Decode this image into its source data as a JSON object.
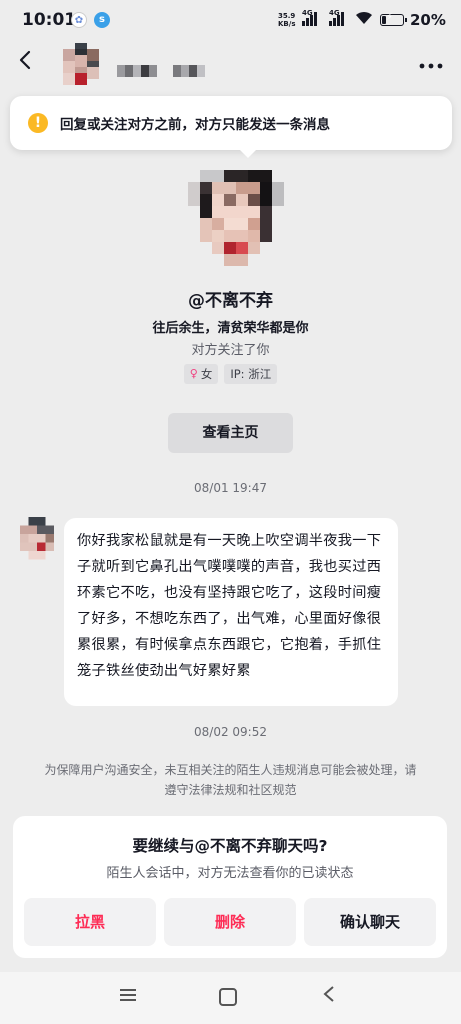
{
  "status_bar": {
    "time": "10:01",
    "net_speed_value": "35.9",
    "net_speed_unit": "KB/s",
    "signal1_label": "4G",
    "signal2_label": "4G",
    "battery_percent": "20%",
    "battery_level": 0.2,
    "icons": [
      "app-notification-icon",
      "app-notification-icon-2",
      "signal-icon",
      "wifi-icon",
      "battery-icon"
    ]
  },
  "header": {
    "back_icon": "chevron-left-icon",
    "more_icon": "more-dots-icon"
  },
  "notice": {
    "icon": "warning-icon",
    "text": "回复或关注对方之前，对方只能发送一条消息"
  },
  "profile": {
    "nickname": "@不离不弃",
    "bio": "往后余生，清贫荣华都是你",
    "follow_note": "对方关注了你",
    "tags": [
      "女",
      "IP: 浙江"
    ],
    "view_home_label": "查看主页"
  },
  "messages": [
    {
      "timestamp": "08/01 19:47",
      "text": "你好我家松鼠就是有一天晚上吹空调半夜我一下子就听到它鼻孔出气噗噗噗的声音，我也买过西环素它不吃，也没有坚持跟它吃了，这段时间瘦了好多，不想吃东西了，出气难，心里面好像很累很累，有时候拿点东西跟它，它抱着，手抓住笼子铁丝使劲出气好累好累"
    }
  ],
  "system": {
    "timestamp": "08/02 09:52",
    "safety_notice": "为保障用户沟通安全，未互相关注的陌生人违规消息可能会被处理，请遵守法律法规和社区规范"
  },
  "continue_card": {
    "title": "要继续与@不离不弃聊天吗?",
    "subtitle": "陌生人会话中，对方无法查看你的已读状态",
    "block_label": "拉黑",
    "delete_label": "删除",
    "confirm_label": "确认聊天"
  },
  "colors": {
    "background": "#ededed",
    "accent_red": "#fe2c55",
    "warning": "#fbb924"
  }
}
